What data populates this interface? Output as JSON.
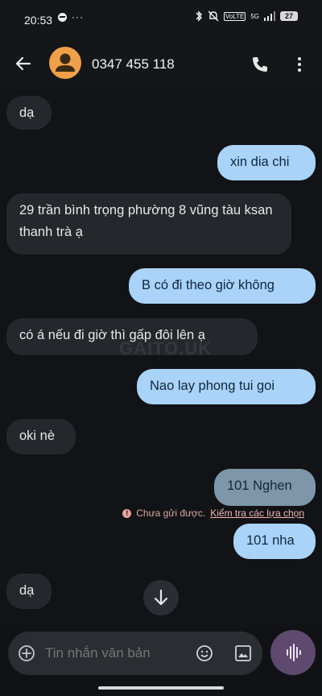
{
  "status_bar": {
    "time": "20:53",
    "right_text": "5G",
    "battery": "27",
    "volte": "VoLTE"
  },
  "header": {
    "contact": "0347 455 118"
  },
  "messages": [
    {
      "dir": "in",
      "text": "dạ"
    },
    {
      "dir": "out",
      "text": "xin dia chi"
    },
    {
      "dir": "in",
      "text": "29 trần bình trọng phường 8 vũng tàu ksan thanh trà ạ"
    },
    {
      "dir": "out",
      "text": "B có đi theo giờ không"
    },
    {
      "dir": "in",
      "text": "có á nếu đi giờ thì gấp đôi lên ạ"
    },
    {
      "dir": "out",
      "text": "Nao lay phong tui goi"
    },
    {
      "dir": "in",
      "text": "oki nè"
    },
    {
      "dir": "out",
      "text": "101 Nghen"
    },
    {
      "dir": "out",
      "text": "101 nha"
    },
    {
      "dir": "in",
      "text": "dạ"
    }
  ],
  "error": {
    "text": "Chưa gửi được.",
    "link": "Kiểm tra các lựa chọn",
    "icon": "!"
  },
  "watermark": "GAITO.UK",
  "composer": {
    "placeholder": "Tin nhắn văn bản"
  },
  "icons": {
    "back": "arrow-back-icon",
    "avatar": "person-icon",
    "call": "phone-icon",
    "more": "more-vert-icon",
    "scroll": "arrow-down-icon",
    "add": "add-emoji-icon",
    "emoji": "smile-icon",
    "gallery": "image-icon",
    "voice": "waveform-icon"
  },
  "colors": {
    "incoming_bubble": "#24272c",
    "outgoing_bubble": "#a9d3f9",
    "failed_bubble": "#7e96a9",
    "avatar": "#f0a048",
    "voice_button": "#5e4a6e"
  }
}
